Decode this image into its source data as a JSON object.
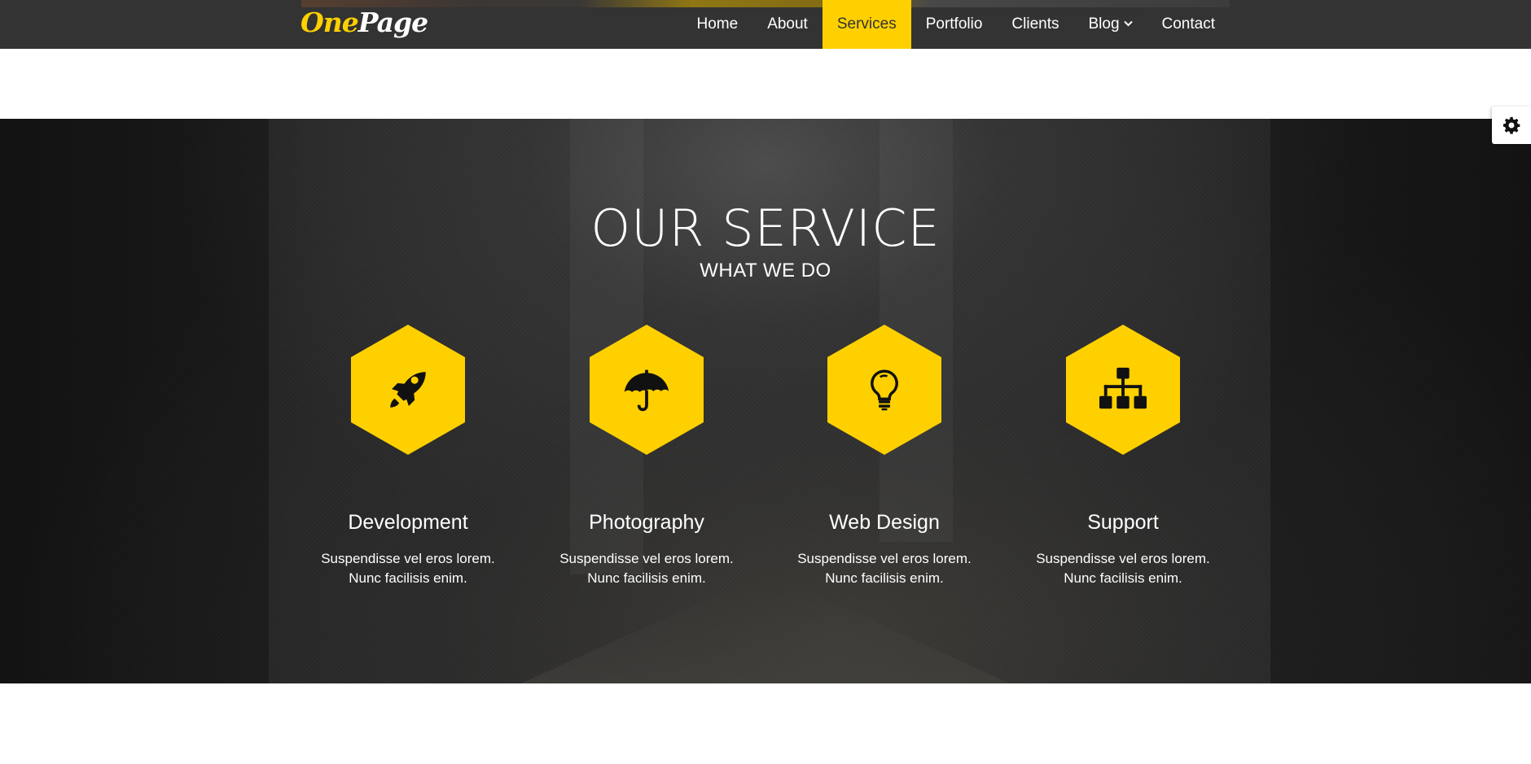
{
  "brand": {
    "logo_part1": "One",
    "logo_part2": "Page"
  },
  "nav": {
    "items": [
      {
        "label": "Home"
      },
      {
        "label": "About"
      },
      {
        "label": "Services",
        "active": true
      },
      {
        "label": "Portfolio"
      },
      {
        "label": "Clients"
      },
      {
        "label": "Blog",
        "has_dropdown": true
      },
      {
        "label": "Contact"
      }
    ]
  },
  "settings": {
    "icon": "gear-icon"
  },
  "services": {
    "title": "OUR SERVICE",
    "subtitle": "WHAT WE DO",
    "items": [
      {
        "icon": "rocket-icon",
        "title": "Development",
        "line1": "Suspendisse vel eros lorem.",
        "line2": "Nunc facilisis enim."
      },
      {
        "icon": "umbrella-icon",
        "title": "Photography",
        "line1": "Suspendisse vel eros lorem.",
        "line2": "Nunc facilisis enim."
      },
      {
        "icon": "lightbulb-icon",
        "title": "Web Design",
        "line1": "Suspendisse vel eros lorem.",
        "line2": "Nunc facilisis enim."
      },
      {
        "icon": "sitemap-icon",
        "title": "Support",
        "line1": "Suspendisse vel eros lorem.",
        "line2": "Nunc facilisis enim."
      }
    ]
  },
  "colors": {
    "accent": "#fed000",
    "header_bg": "#333333",
    "text": "#ffffff"
  }
}
